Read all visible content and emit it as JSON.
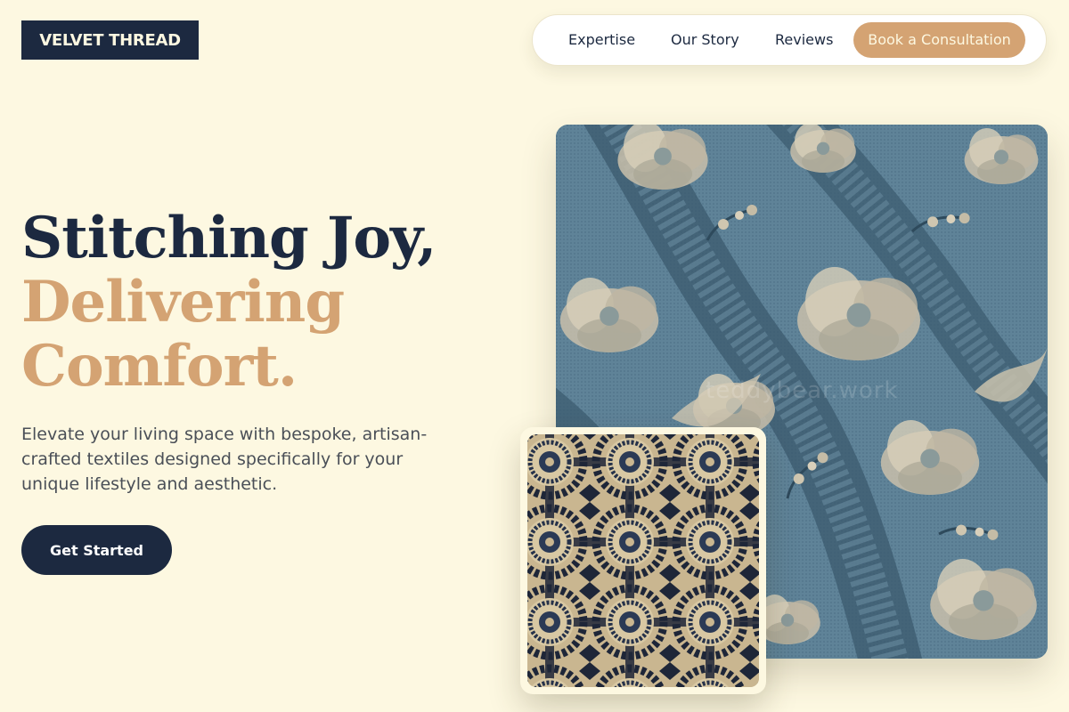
{
  "brand": {
    "logo_text": "VELVET THREAD"
  },
  "nav": {
    "links": [
      {
        "label": "Expertise"
      },
      {
        "label": "Our Story"
      },
      {
        "label": "Reviews"
      }
    ],
    "cta_label": "Book a Consultation"
  },
  "hero": {
    "headline_line1": "Stitching Joy,",
    "headline_line2": "Delivering",
    "headline_line3": "Comfort.",
    "subcopy": "Elevate your living space with bespoke, artisan-crafted textiles designed specifically for your unique lifestyle and aesthetic.",
    "cta_label": "Get Started"
  },
  "images": {
    "main_fabric": {
      "description": "blue brocade fabric with cream floral pattern",
      "watermark": "teddybear.work"
    },
    "card_fabric": {
      "description": "navy and cream circular medallion textile pattern"
    }
  },
  "colors": {
    "background": "#fdf8e1",
    "navy": "#1c2940",
    "accent": "#d4a373",
    "body_text": "#4a4f57"
  }
}
